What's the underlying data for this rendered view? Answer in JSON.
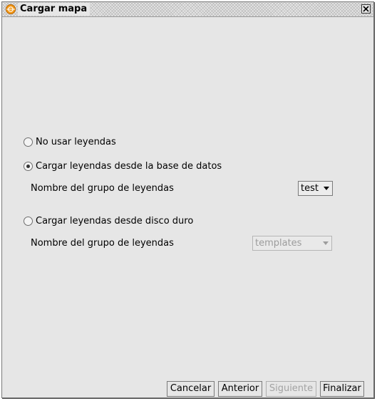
{
  "window": {
    "title": "Cargar mapa",
    "icon": "gvsig-globe-icon",
    "close_icon": "close-icon"
  },
  "options": {
    "no_legends": {
      "label": "No usar leyendas",
      "selected": false
    },
    "from_database": {
      "label": "Cargar leyendas desde la base de datos",
      "selected": true,
      "group_label": "Nombre del grupo de leyendas",
      "group_value": "test",
      "enabled": true
    },
    "from_disk": {
      "label": "Cargar leyendas desde disco duro",
      "selected": false,
      "group_label": "Nombre del grupo de leyendas",
      "group_value": "templates",
      "enabled": false
    }
  },
  "buttons": {
    "cancel": "Cancelar",
    "previous": "Anterior",
    "next": "Siguiente",
    "finish": "Finalizar"
  },
  "colors": {
    "background": "#e6e6e6",
    "icon_orange": "#f39a1a",
    "disabled_text": "#a3a3a3"
  }
}
